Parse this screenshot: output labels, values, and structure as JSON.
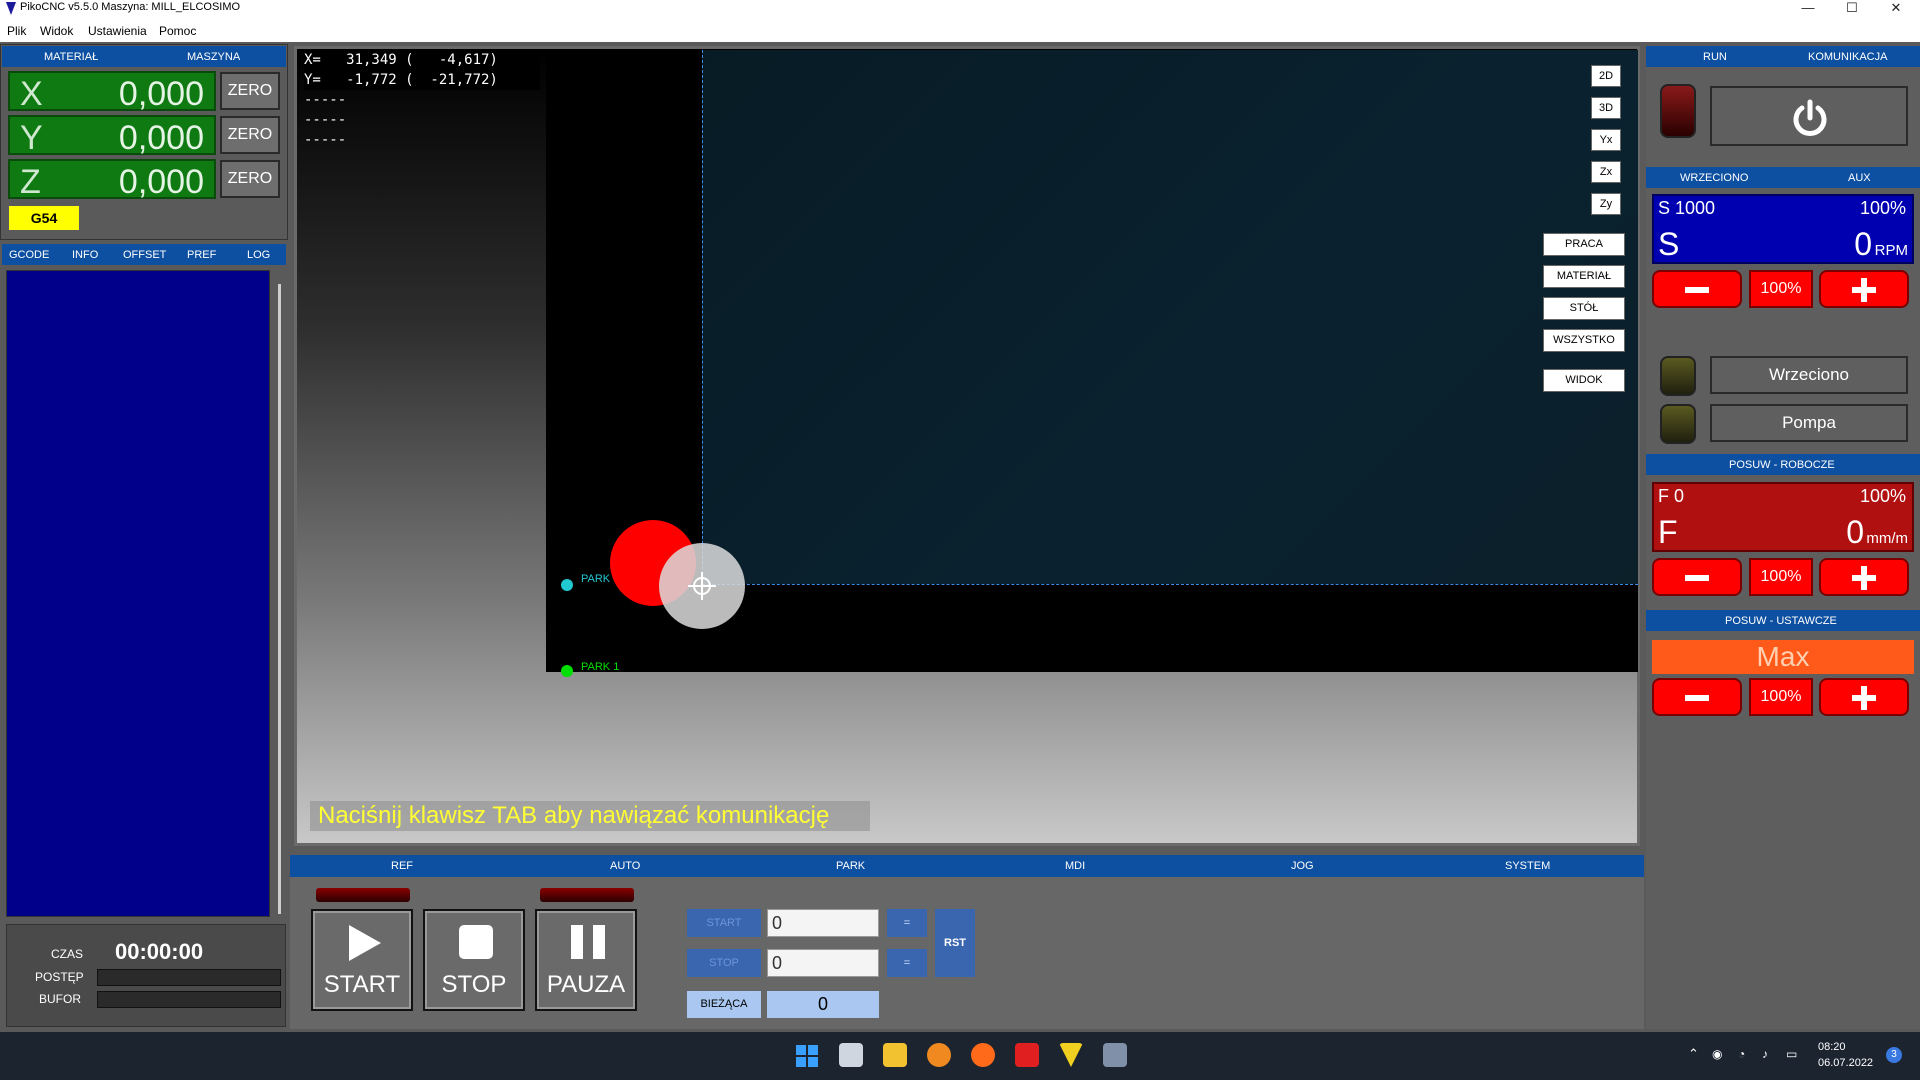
{
  "window": {
    "title": "PikoCNC v5.5.0   Maszyna: MILL_ELCOSIMO",
    "minimize": "—",
    "maximize": "☐",
    "close": "✕"
  },
  "menu": [
    "Plik",
    "Widok",
    "Ustawienia",
    "Pomoc"
  ],
  "coords_panel": {
    "tabs": [
      "MATERIAŁ",
      "MASZYNA"
    ],
    "axes": [
      {
        "label": "X",
        "value": "0,000"
      },
      {
        "label": "Y",
        "value": "0,000"
      },
      {
        "label": "Z",
        "value": "0,000"
      }
    ],
    "zero_label": "ZERO",
    "wcs": "G54"
  },
  "left_tabs": [
    "GCODE",
    "INFO",
    "OFFSET",
    "PREF",
    "LOG"
  ],
  "status": {
    "time_label": "CZAS",
    "time_value": "00:00:00",
    "progress_label": "POSTĘP",
    "buffer_label": "BUFOR"
  },
  "viewport": {
    "coord_lines": "X=   31,349 (   -4,617)\nY=   -1,772 (  -21,772)\n-----\n-----\n-----",
    "view_buttons": [
      "2D",
      "3D",
      "Yx",
      "Zx",
      "Zy"
    ],
    "work_buttons": [
      "PRACA",
      "MATERIAŁ",
      "STÓŁ",
      "WSZYSTKO",
      "WIDOK"
    ],
    "park_labels": [
      "PARK",
      "PARK 1"
    ],
    "message": "Naciśnij klawisz TAB aby nawiązać komunikację"
  },
  "bottom_tabs": [
    "REF",
    "AUTO",
    "PARK",
    "MDI",
    "JOG",
    "SYSTEM"
  ],
  "controls": {
    "start": "START",
    "stop": "STOP",
    "pause": "PAUZA",
    "line_start_label": "START",
    "line_stop_label": "STOP",
    "line_start_value": "0",
    "line_stop_value": "0",
    "equals": "=",
    "rst": "RST",
    "current_label": "BIEŻĄCA",
    "current_value": "0"
  },
  "right": {
    "tabs_top": [
      "RUN",
      "KOMUNIKACJA"
    ],
    "tabs_spindle": [
      "WRZECIONO",
      "AUX"
    ],
    "spindle": {
      "set": "S 1000",
      "pct": "100%",
      "letter": "S",
      "value": "0",
      "unit": "RPM",
      "btn_pct": "100%"
    },
    "aux": [
      "Wrzeciono",
      "Pompa"
    ],
    "feed_head": "POSUW - ROBOCZE",
    "feed": {
      "set": "F 0",
      "pct": "100%",
      "letter": "F",
      "value": "0",
      "unit": "mm/m",
      "btn_pct": "100%"
    },
    "rapid_head": "POSUW - USTAWCZE",
    "rapid": {
      "value": "Max",
      "btn_pct": "100%"
    }
  },
  "taskbar": {
    "time": "08:20",
    "date": "06.07.2022",
    "badge": "3"
  },
  "colors": {
    "accent": "#0d4fa0",
    "axis_green": "#0f7a12",
    "gcode_bg": "#00008b",
    "spindle_bg": "#0000b0",
    "feed_bg": "#b01010",
    "rapid_bg": "#ff5a1a"
  }
}
